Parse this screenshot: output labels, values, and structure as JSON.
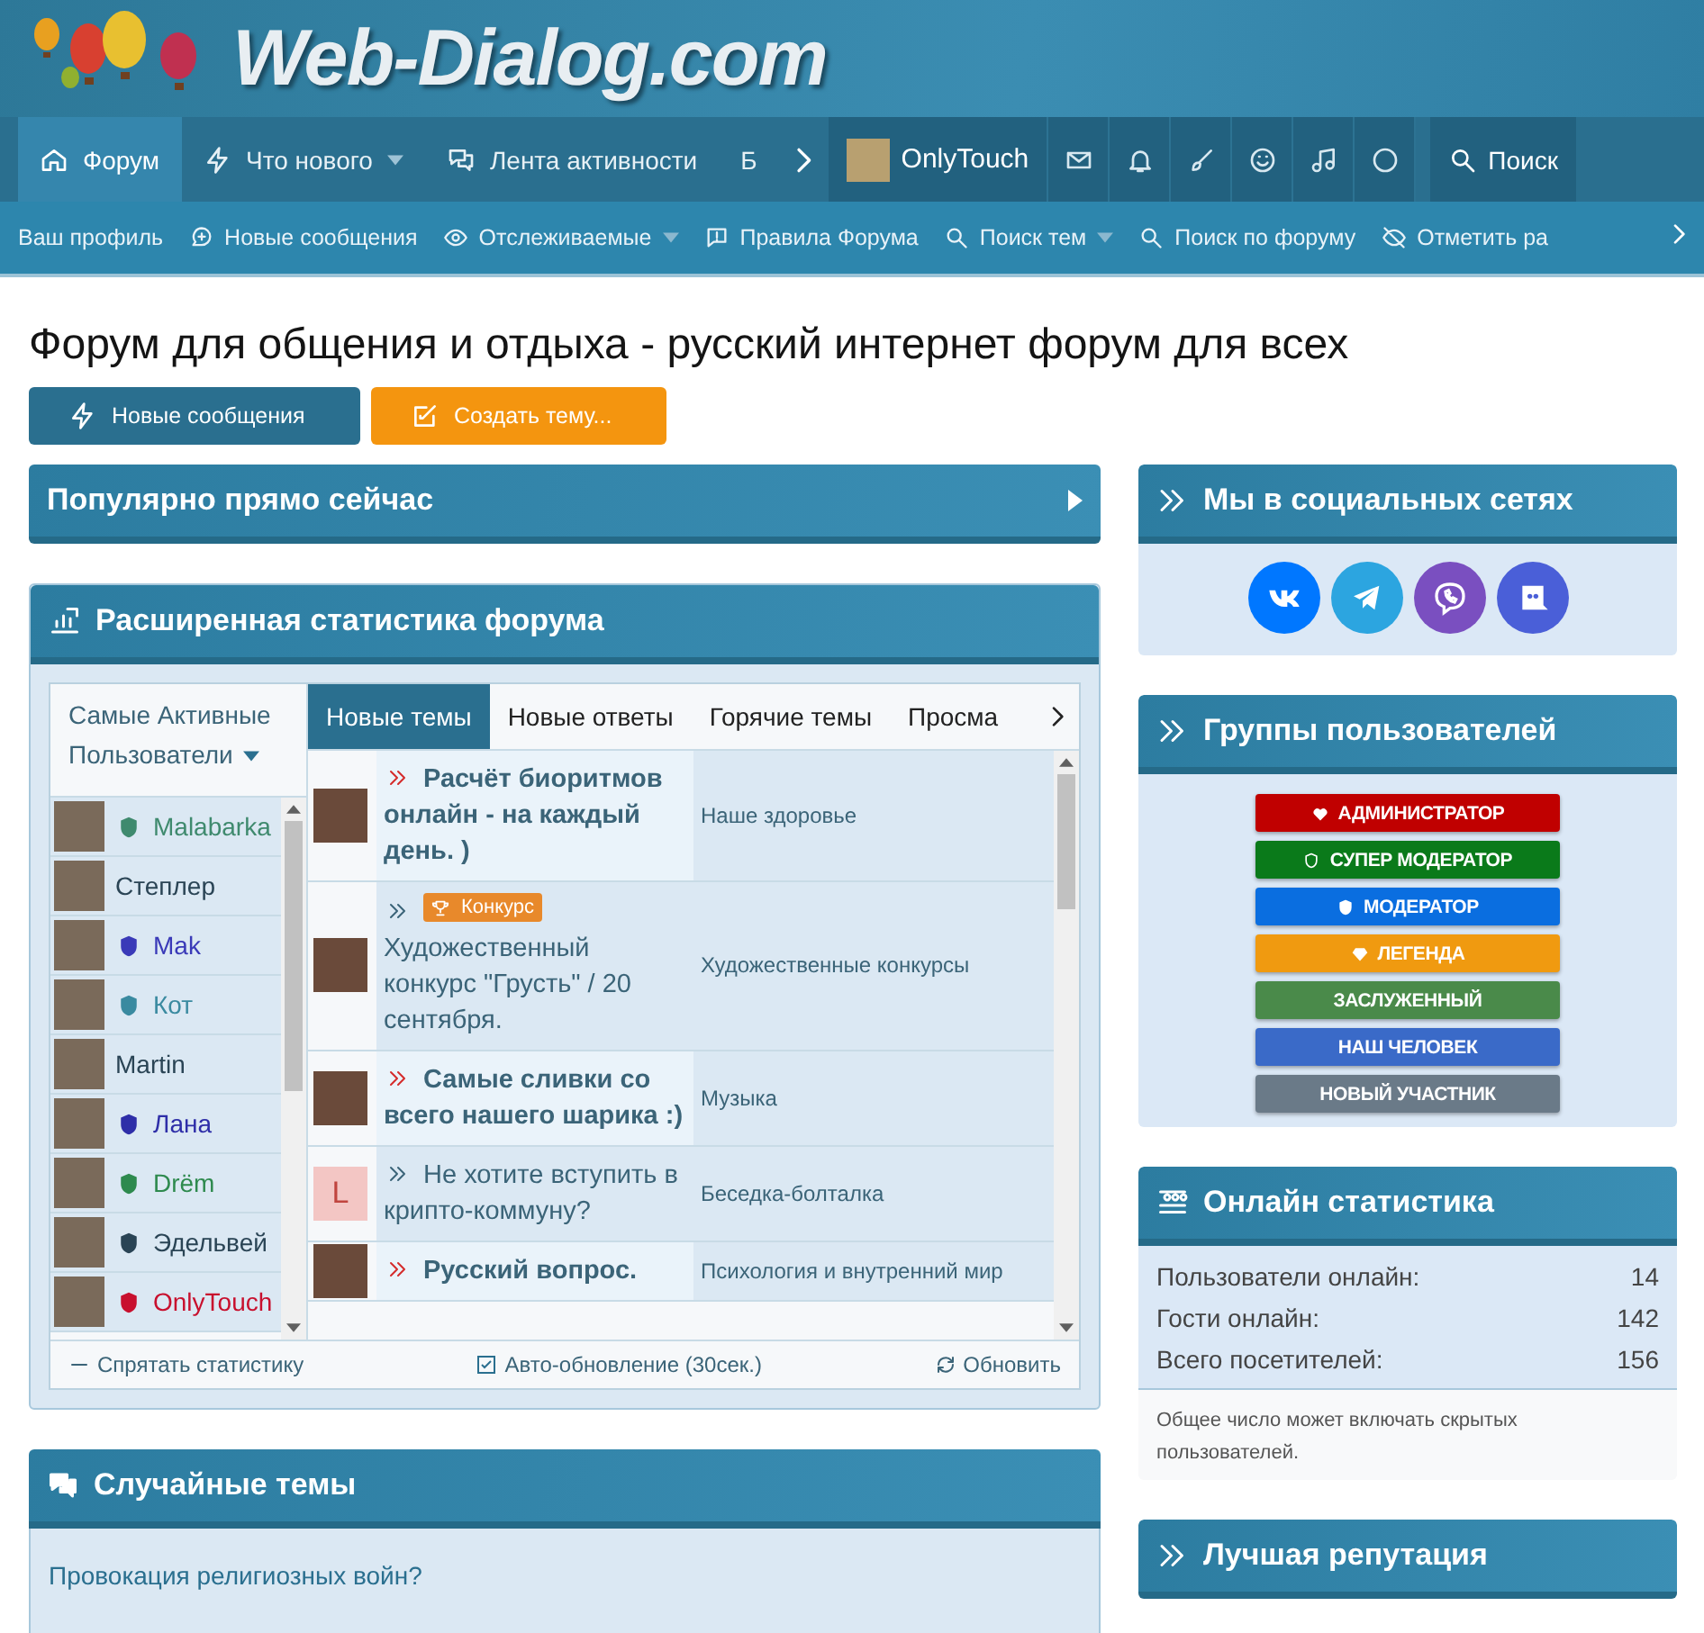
{
  "header": {
    "logo": "Web-Dialog.com"
  },
  "nav": {
    "tabs": [
      {
        "label": "Форум",
        "selected": true,
        "dropdown": false
      },
      {
        "label": "Что нового",
        "selected": false,
        "dropdown": true
      },
      {
        "label": "Лента активности",
        "selected": false,
        "dropdown": false
      },
      {
        "label": "Б",
        "selected": false,
        "dropdown": false
      }
    ],
    "user": "OnlyTouch",
    "search": "Поиск"
  },
  "subnav": [
    {
      "label": "Ваш профиль",
      "dropdown": false
    },
    {
      "label": "Новые сообщения",
      "dropdown": false
    },
    {
      "label": "Отслеживаемые",
      "dropdown": true
    },
    {
      "label": "Правила Форума",
      "dropdown": false
    },
    {
      "label": "Поиск тем",
      "dropdown": true
    },
    {
      "label": "Поиск по форуму",
      "dropdown": false
    },
    {
      "label": "Отметить ра",
      "dropdown": false
    }
  ],
  "page_title": "Форум для общения и отдыха - русский интернет форум для всех",
  "actions": [
    {
      "label": "Новые сообщения",
      "kind": "primary"
    },
    {
      "label": "Создать тему...",
      "kind": "accent"
    }
  ],
  "popular": {
    "title": "Популярно прямо сейчас"
  },
  "stats": {
    "title": "Расширенная статистика форума",
    "users_header": "Самые Активные Пользователи",
    "users": [
      {
        "name": "Malabarka",
        "color": "#3f8a6e",
        "badge": true
      },
      {
        "name": "Степлер",
        "color": "#2a4455",
        "badge": false
      },
      {
        "name": "Mak",
        "color": "#3a3ab8",
        "badge": true
      },
      {
        "name": "Кот",
        "color": "#3a8aa0",
        "badge": true
      },
      {
        "name": "Martin",
        "color": "#2a4455",
        "badge": false
      },
      {
        "name": "Лана",
        "color": "#2e2ea8",
        "badge": true
      },
      {
        "name": "Drëm",
        "color": "#2e8a4e",
        "badge": true
      },
      {
        "name": "Эдельвей",
        "color": "#2a4455",
        "badge": true
      },
      {
        "name": "OnlyTouch",
        "color": "#c8102e",
        "badge": true
      }
    ],
    "tabs": [
      {
        "label": "Новые темы",
        "selected": true
      },
      {
        "label": "Новые ответы",
        "selected": false
      },
      {
        "label": "Горячие темы",
        "selected": false
      },
      {
        "label": "Просма",
        "selected": false
      }
    ],
    "topics": [
      {
        "title": "Расчёт биоритмов онлайн - на каждый день. )",
        "forum": "Наше здоровье",
        "unread": true,
        "avatar": {
          "kind": "photo"
        }
      },
      {
        "title": "Художественный конкурс \"Грусть\" / 20 сентября.",
        "forum": "Художественные конкурсы",
        "unread": false,
        "prefix": "Конкурс",
        "avatar": {
          "kind": "photo"
        }
      },
      {
        "title": "Самые сливки со всего нашего шарика :)",
        "forum": "Музыка",
        "unread": true,
        "avatar": {
          "kind": "photo"
        }
      },
      {
        "title": "Не хотите вступить в крипто-коммуну?",
        "forum": "Беседка-болталка",
        "unread": false,
        "avatar": {
          "kind": "letter",
          "letter": "L"
        }
      },
      {
        "title": "Русский вопрос.",
        "forum": "Психология и внутренний мир",
        "unread": true,
        "avatar": {
          "kind": "photo"
        }
      }
    ],
    "footer": {
      "hide": "Спрятать статистику",
      "auto": {
        "label": "Авто-обновление (30сек.)",
        "checked": true
      },
      "refresh": "Обновить"
    }
  },
  "random": {
    "title": "Случайные темы",
    "items": [
      "Провокация религиозных войн?"
    ]
  },
  "social": {
    "title": "Мы в социальных сетях",
    "links": [
      {
        "color": "#0077ff"
      },
      {
        "color": "#2ca5e0"
      },
      {
        "color": "#7a4fc0"
      },
      {
        "color": "#4a5fd8"
      }
    ]
  },
  "groups": {
    "title": "Группы пользователей",
    "items": [
      {
        "label": "АДМИНИСТРАТОР",
        "color": "#c00000"
      },
      {
        "label": "СУПЕР МОДЕРАТОР",
        "color": "#0a7a1a"
      },
      {
        "label": "МОДЕРАТОР",
        "color": "#0a6ee0"
      },
      {
        "label": "ЛЕГЕНДА",
        "color": "#f09a10"
      },
      {
        "label": "ЗАСЛУЖЕННЫЙ",
        "color": "#4a8a4a"
      },
      {
        "label": "НАШ ЧЕЛОВЕК",
        "color": "#3a6ac8"
      },
      {
        "label": "НОВЫЙ УЧАСТНИК",
        "color": "#6a7a88"
      }
    ]
  },
  "online": {
    "title": "Онлайн статистика",
    "rows": [
      {
        "label": "Пользователи онлайн:",
        "value": "14"
      },
      {
        "label": "Гости онлайн:",
        "value": "142"
      },
      {
        "label": "Всего посетителей:",
        "value": "156"
      }
    ],
    "note": "Общее число может включать скрытых пользователей."
  },
  "reputation": {
    "title": "Лучшая репутация"
  }
}
